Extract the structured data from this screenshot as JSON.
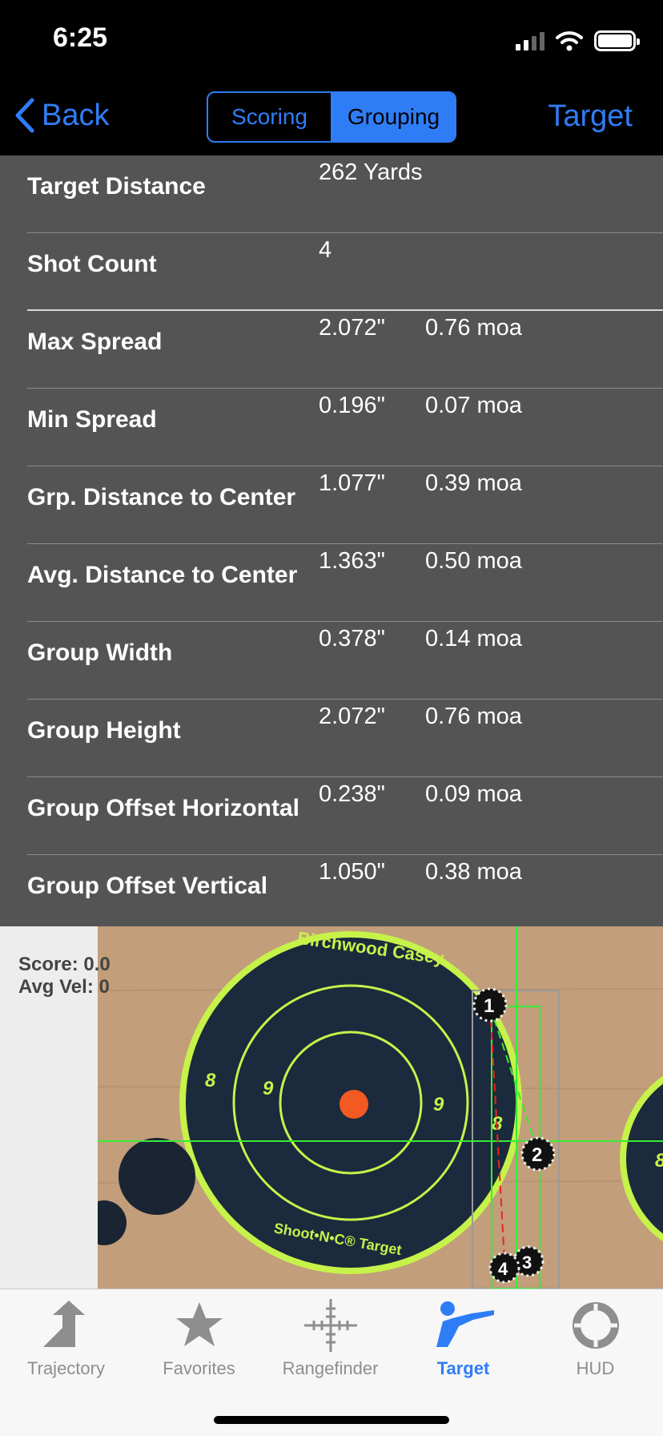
{
  "status_bar": {
    "time": "6:25"
  },
  "nav": {
    "back_label": "Back",
    "segments": [
      {
        "label": "Scoring",
        "active": false
      },
      {
        "label": "Grouping",
        "active": true
      }
    ],
    "right_label": "Target"
  },
  "stats": [
    {
      "label": "Target Distance",
      "value": "262 Yards",
      "moa": ""
    },
    {
      "label": "Shot Count",
      "value": "4",
      "moa": ""
    },
    {
      "label": "Max Spread",
      "value": "2.072\"",
      "moa": "0.76 moa"
    },
    {
      "label": "Min Spread",
      "value": "0.196\"",
      "moa": "0.07 moa"
    },
    {
      "label": "Grp. Distance to Center",
      "value": "1.077\"",
      "moa": "0.39 moa"
    },
    {
      "label": "Avg. Distance to Center",
      "value": "1.363\"",
      "moa": "0.50 moa"
    },
    {
      "label": "Group Width",
      "value": "0.378\"",
      "moa": "0.14 moa"
    },
    {
      "label": "Group Height",
      "value": "2.072\"",
      "moa": "0.76 moa"
    },
    {
      "label": "Group Offset Horizontal",
      "value": "0.238\"",
      "moa": "0.09 moa"
    },
    {
      "label": "Group Offset Vertical",
      "value": "1.050\"",
      "moa": "0.38 moa"
    }
  ],
  "target": {
    "score_line": "Score: 0.0",
    "velocity_line": "Avg Vel: 0",
    "brand_text": "Birchwood Casey",
    "bottom_text": "Shoot•N•C® Target",
    "ring_labels": [
      "8",
      "9",
      "9",
      "8",
      "8"
    ],
    "shots": [
      "1",
      "2",
      "3",
      "4"
    ]
  },
  "tabs": [
    {
      "label": "Trajectory",
      "icon": "trajectory-icon",
      "active": false
    },
    {
      "label": "Favorites",
      "icon": "star-icon",
      "active": false
    },
    {
      "label": "Rangefinder",
      "icon": "crosshair-icon",
      "active": false
    },
    {
      "label": "Target",
      "icon": "rifleman-icon",
      "active": true
    },
    {
      "label": "HUD",
      "icon": "hud-ring-icon",
      "active": false
    }
  ],
  "colors": {
    "accent": "#2f7df6",
    "panel": "#545454",
    "target_green": "#c6f24a",
    "overlay_green": "#33ee33"
  }
}
